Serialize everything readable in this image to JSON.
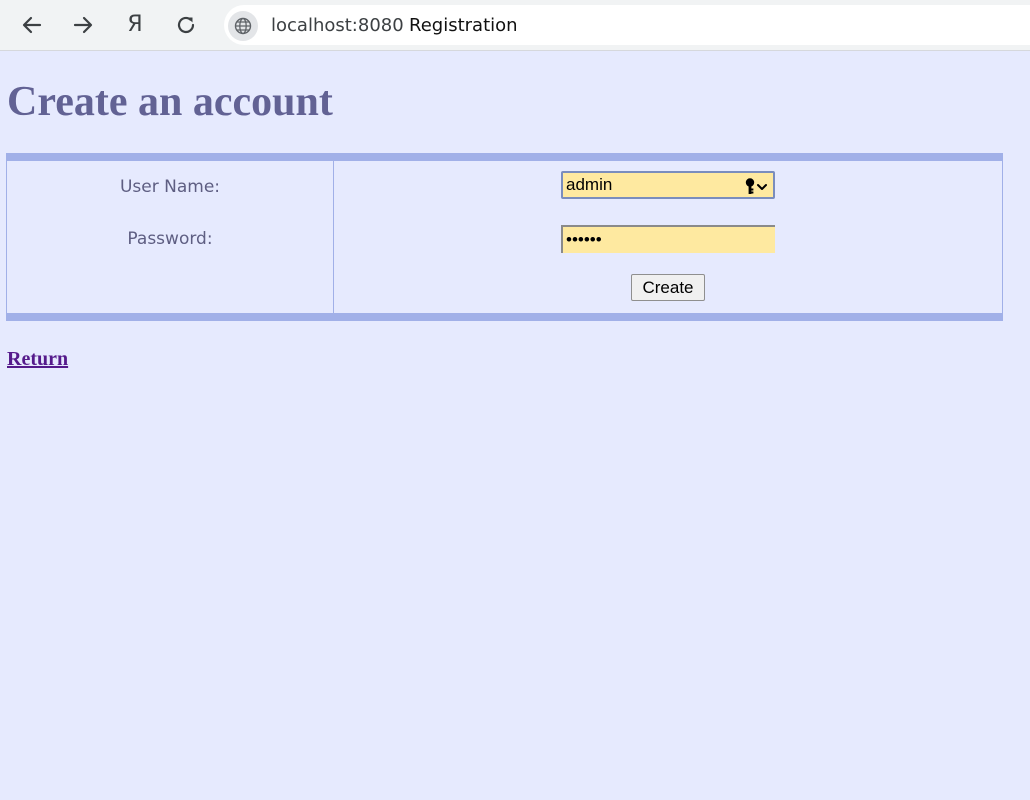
{
  "browser": {
    "url": "localhost:8080",
    "title": "Registration",
    "yandex_glyph": "Я",
    "icons": [
      "back-arrow-icon",
      "forward-arrow-icon",
      "yandex-icon",
      "reload-icon",
      "globe-icon"
    ]
  },
  "page": {
    "heading": "Create an account",
    "return_link": "Return"
  },
  "form": {
    "username_label": "User Name:",
    "username_value": "admin",
    "password_label": "Password:",
    "password_value": "••••••",
    "submit_label": "Create"
  },
  "colors": {
    "page_background": "#e6eafe",
    "heading": "#626294",
    "table_border": "#a1b0e8",
    "autofill_background": "#fee9a0",
    "link_visited": "#551a8b"
  }
}
